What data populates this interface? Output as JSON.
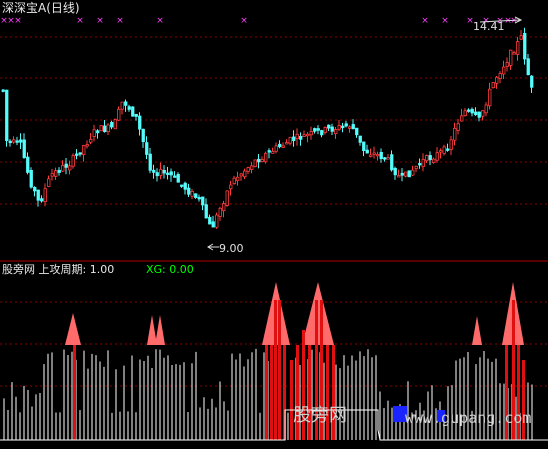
{
  "header": {
    "security_name": "深深宝A",
    "period": "(日线)"
  },
  "price_panel": {
    "high_label": "14.41",
    "low_label": "9.00",
    "marker_symbol": "×"
  },
  "indicator_panel": {
    "title": "股旁网 上攻周期: 1.00",
    "xg_text": "XG: 0.00"
  },
  "watermark": {
    "text": "股旁网",
    "url": "www.gupang.com"
  },
  "colors": {
    "background": "#000000",
    "up_candle": "#ff3c3c",
    "down_candle": "#54fcfc",
    "grid": "#8b0000",
    "marker": "#ff40ff",
    "bar_white": "#ffffff",
    "bar_red": "#e01010",
    "peak_fill": "#ff6a6a",
    "blue_block": "#1a24ff",
    "xg_green": "#00ff00"
  }
}
